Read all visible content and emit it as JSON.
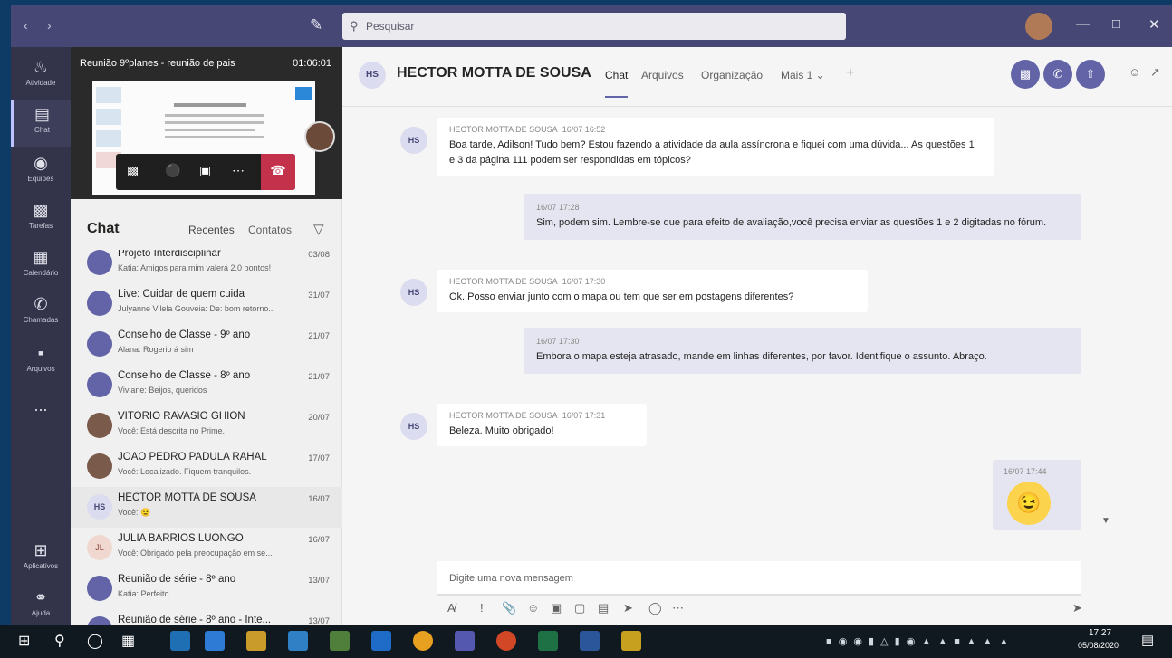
{
  "titlebar": {
    "search_placeholder": "Pesquisar",
    "back_icon": "chevron-left-icon",
    "forward_icon": "chevron-right-icon",
    "compose_icon": "new-chat-icon"
  },
  "rail": {
    "items": [
      {
        "label": "Atividade",
        "icon": "bell-icon"
      },
      {
        "label": "Chat",
        "icon": "chat-icon"
      },
      {
        "label": "Equipes",
        "icon": "teams-icon"
      },
      {
        "label": "Tarefas",
        "icon": "assignments-icon"
      },
      {
        "label": "Calendário",
        "icon": "calendar-icon"
      },
      {
        "label": "Chamadas",
        "icon": "phone-icon"
      },
      {
        "label": "Arquivos",
        "icon": "files-icon"
      },
      {
        "label": "...",
        "icon": "more-icon"
      },
      {
        "label": "Aplicativos",
        "icon": "apps-icon"
      },
      {
        "label": "Ajuda",
        "icon": "help-icon"
      }
    ]
  },
  "meeting": {
    "title": "Reunião 9ºplanes - reunião de pais",
    "time": "01:06:01"
  },
  "chat_panel": {
    "title": "Chat",
    "tab_recent": "Recentes",
    "tab_contacts": "Contatos"
  },
  "chat_list": [
    {
      "name": "Projeto Interdisciplinar",
      "preview": "Katia: Amigos para mim valerá 2.0 pontos!",
      "date": "03/08",
      "avatar": "",
      "style": "group"
    },
    {
      "name": "Live: Cuidar de quem cuida",
      "preview": "Julyanne Vilela Gouveia: De: bom retorno...",
      "date": "31/07",
      "avatar": "",
      "style": "group"
    },
    {
      "name": "Conselho de Classe - 9º ano",
      "preview": "Alana: Rogerio á sim",
      "date": "21/07",
      "avatar": "",
      "style": "group"
    },
    {
      "name": "Conselho de Classe - 8º ano",
      "preview": "Viviane: Beijos, queridos",
      "date": "21/07",
      "avatar": "",
      "style": "group"
    },
    {
      "name": "VITORIO RAVASIO GHION",
      "preview": "Você: Está descrita no Prime.",
      "date": "20/07",
      "avatar": "",
      "style": "photo"
    },
    {
      "name": "JOAO PEDRO PADULA RAHAL",
      "preview": "Você: Localizado. Fiquem tranquilos.",
      "date": "17/07",
      "avatar": "",
      "style": "photo"
    },
    {
      "name": "HECTOR MOTTA DE SOUSA",
      "preview": "Você: 😉",
      "date": "16/07",
      "avatar": "HS",
      "style": "hs"
    },
    {
      "name": "JULIA BARRIOS LUONGO",
      "preview": "Você: Obrigado pela preocupação em se...",
      "date": "16/07",
      "avatar": "JL",
      "style": "jb"
    },
    {
      "name": "Reunião de série - 8º ano",
      "preview": "Katia: Perfeito",
      "date": "13/07",
      "avatar": "",
      "style": "group"
    },
    {
      "name": "Reunião de série - 8º ano - Inte...",
      "preview": "",
      "date": "13/07",
      "avatar": "",
      "style": "group"
    }
  ],
  "conversation": {
    "avatar": "HS",
    "name": "HECTOR MOTTA DE SOUSA",
    "tabs": [
      "Chat",
      "Arquivos",
      "Organização",
      "Mais 1 ⌄",
      "+"
    ],
    "messages": [
      {
        "dir": "in",
        "author": "HECTOR MOTTA DE SOUSA",
        "time": "16/07 16:52",
        "text": "Boa tarde, Adilson! Tudo bem? Estou fazendo a atividade da aula assíncrona e fiquei com uma dúvida... As questões 1 e 3 da página 111 podem ser respondidas em tópicos?"
      },
      {
        "dir": "out",
        "time": "16/07 17:28",
        "text": "Sim, podem sim. Lembre-se que para efeito de avaliação,você precisa enviar as questões 1 e 2 digitadas no fórum."
      },
      {
        "dir": "in",
        "author": "HECTOR MOTTA DE SOUSA",
        "time": "16/07 17:30",
        "text": "Ok. Posso enviar junto com o mapa ou tem que ser em postagens diferentes?"
      },
      {
        "dir": "out",
        "time": "16/07 17:30",
        "text": "Embora o mapa esteja atrasado, mande em linhas diferentes, por favor. Identifique o assunto. Abraço."
      },
      {
        "dir": "in",
        "author": "HECTOR MOTTA DE SOUSA",
        "time": "16/07 17:31",
        "text": "Beleza. Muito obrigado!"
      },
      {
        "dir": "out",
        "time": "16/07 17:44",
        "text": "😉"
      }
    ],
    "compose_placeholder": "Digite uma nova mensagem"
  },
  "taskbar": {
    "time": "17:27",
    "date": "05/08/2020"
  }
}
